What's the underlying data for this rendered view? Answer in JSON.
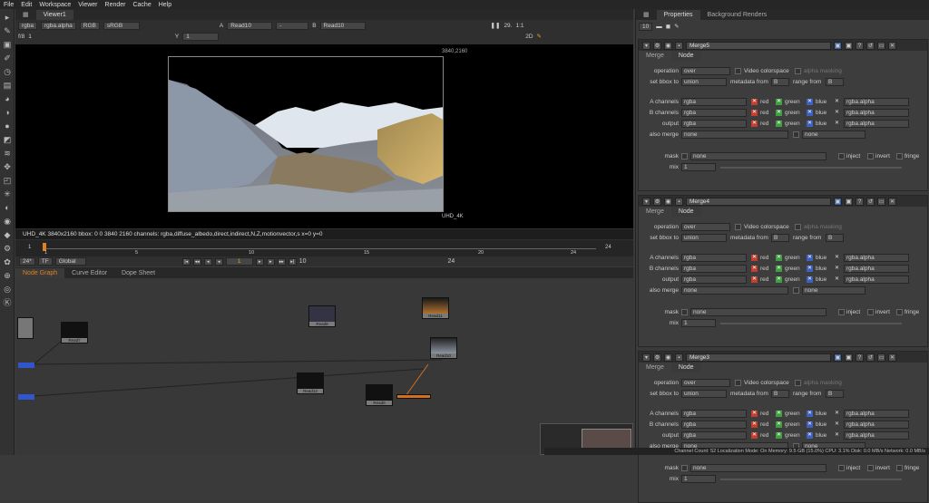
{
  "menu": [
    "File",
    "Edit",
    "Workspace",
    "Viewer",
    "Render",
    "Cache",
    "Help"
  ],
  "viewer": {
    "tab": "Viewer1",
    "channels": "rgba",
    "alpha": "rgba.alpha",
    "colorspace_a": "RGB",
    "colorspace_b": "sRGB",
    "input_a": "A",
    "read_a": "Read10",
    "dash": "-",
    "input_b": "B",
    "read_b": "Read10",
    "fps": "29.",
    "zoom": "1:1",
    "mode": "2D",
    "fstop": "f/8",
    "frame_in": "1",
    "y_label": "Y",
    "y_value": "1",
    "res_label": "3840,2160",
    "format_label": "UHD_4K",
    "info": "UHD_4K 3840x2160  bbox: 0 0 3840 2160 channels: rgba,diffuse_albedo,direct,indirect,N,Z,motionvector,s  x=0 y=0"
  },
  "timeline": {
    "start": "1",
    "end": "24",
    "ticks": [
      "1",
      "5",
      "10",
      "15",
      "20",
      "24"
    ],
    "fps_value": "24*",
    "tf": "TF",
    "global": "Global",
    "cur_frame": "1",
    "step": "10",
    "end_frame": "24"
  },
  "nodegraph": {
    "tabs": [
      "Node Graph",
      "Curve Editor",
      "Dope Sheet"
    ],
    "nodes": [
      {
        "label": "Read7",
        "sub": "dlp_1.exr"
      },
      {
        "label": "Read8",
        "sub": "dlp_1.exr"
      },
      {
        "label": "Read11",
        "sub": "dlp_1.exr"
      },
      {
        "label": "Read10",
        "sub": "dlp_1.exr"
      },
      {
        "label": "Read12",
        "sub": "dlp_1.exr"
      },
      {
        "label": "Read9",
        "sub": "dlp_1.exr"
      }
    ]
  },
  "props": {
    "tabs": [
      "Properties",
      "Background Renders"
    ],
    "count": "10",
    "panels": [
      {
        "name": "Merge5",
        "tabs": [
          "Merge",
          "Node"
        ],
        "operation": "over",
        "video_cs": "Video colorspace",
        "alpha_mask": "alpha masking",
        "bbox": "union",
        "meta_from": "metadata from",
        "meta_val": "B",
        "range_from": "range from",
        "range_val": "B",
        "a_ch": "rgba",
        "b_ch": "rgba",
        "out_ch": "rgba",
        "also": "none",
        "also2": "none",
        "mask": "none",
        "inject": "inject",
        "invert": "invert",
        "fringe": "fringe",
        "mix": "1",
        "alpha_name": "rgba.alpha"
      },
      {
        "name": "Merge4",
        "tabs": [
          "Merge",
          "Node"
        ],
        "operation": "over",
        "video_cs": "Video colorspace",
        "alpha_mask": "alpha masking",
        "bbox": "union",
        "meta_from": "metadata from",
        "meta_val": "B",
        "range_from": "range from",
        "range_val": "B",
        "a_ch": "rgba",
        "b_ch": "rgba",
        "out_ch": "rgba",
        "also": "none",
        "also2": "none",
        "mask": "none",
        "inject": "inject",
        "invert": "invert",
        "fringe": "fringe",
        "mix": "1",
        "alpha_name": "rgba.alpha"
      },
      {
        "name": "Merge3",
        "tabs": [
          "Merge",
          "Node"
        ],
        "operation": "over",
        "video_cs": "Video colorspace",
        "alpha_mask": "alpha masking",
        "bbox": "union",
        "meta_from": "metadata from",
        "meta_val": "B",
        "range_from": "range from",
        "range_val": "B",
        "a_ch": "rgba",
        "b_ch": "rgba",
        "out_ch": "rgba",
        "also": "none",
        "also2": "none",
        "mask": "none",
        "inject": "inject",
        "invert": "invert",
        "fringe": "fringe",
        "mix": "1",
        "alpha_name": "rgba.alpha"
      }
    ],
    "labels": {
      "operation": "operation",
      "bbox": "set bbox to",
      "a": "A channels",
      "b": "B channels",
      "out": "output",
      "also": "also merge",
      "mask": "mask",
      "mix": "mix",
      "red": "red",
      "green": "green",
      "blue": "blue"
    }
  },
  "status": "Channel Count: 52  Localization Mode: On  Memory: 9.5 GB (15.0%)  CPU: 3.1%  Disk: 0.0 MB/s  Network: 0.0 MB/s"
}
